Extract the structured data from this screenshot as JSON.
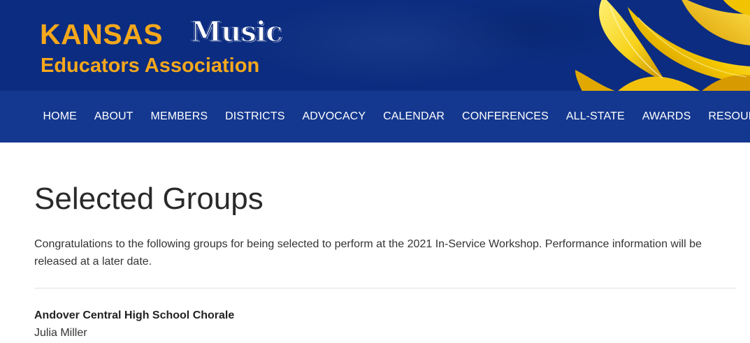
{
  "header": {
    "logo_kansas": "KANSAS",
    "logo_music": "Music",
    "logo_subtitle": "Educators Association",
    "brand_colors": {
      "navy": "#0b2c80",
      "nav_blue": "#14388f",
      "gold": "#f5a81c"
    },
    "decoration": "sunflower-image"
  },
  "nav": {
    "items": [
      {
        "label": "HOME"
      },
      {
        "label": "ABOUT"
      },
      {
        "label": "MEMBERS"
      },
      {
        "label": "DISTRICTS"
      },
      {
        "label": "ADVOCACY"
      },
      {
        "label": "CALENDAR"
      },
      {
        "label": "CONFERENCES"
      },
      {
        "label": "ALL-STATE"
      },
      {
        "label": "AWARDS"
      },
      {
        "label": "RESOURCES"
      }
    ]
  },
  "main": {
    "title": "Selected Groups",
    "intro": "Congratulations to the following groups for being selected to perform at the 2021 In-Service Workshop. Performance information will be released at a later date.",
    "groups": [
      {
        "name": "Andover Central High School Chorale",
        "director": "Julia Miller"
      }
    ]
  }
}
